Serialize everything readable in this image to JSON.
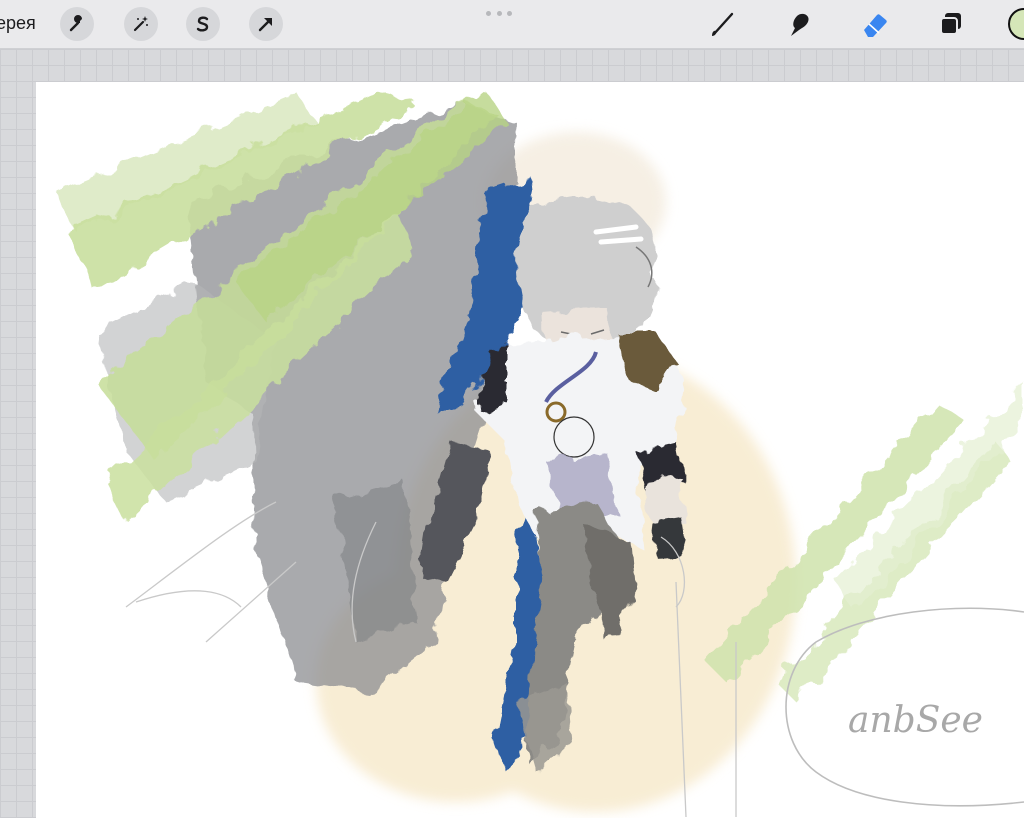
{
  "toolbar": {
    "gallery_label": "ерея",
    "left_tools": [
      {
        "name": "actions",
        "icon": "wrench-icon"
      },
      {
        "name": "adjustments",
        "icon": "magic-wand-icon"
      },
      {
        "name": "selection",
        "icon": "selection-s-icon"
      },
      {
        "name": "transform",
        "icon": "arrow-cursor-icon"
      }
    ],
    "right_tools": [
      {
        "name": "brush",
        "icon": "brush-icon"
      },
      {
        "name": "smudge",
        "icon": "smudge-finger-icon"
      },
      {
        "name": "eraser",
        "icon": "eraser-icon",
        "active": true
      },
      {
        "name": "layers",
        "icon": "layers-icon"
      }
    ],
    "active_color": "#d5e6b8",
    "accent_color": "#3a86f0"
  },
  "canvas": {
    "sketch_text": "anbSee",
    "palette": {
      "green": "#c9df9e",
      "gray": "#8c8d91",
      "blue": "#2f5fa3",
      "cream": "#f6e7c6",
      "hair": "#cfcfcf"
    }
  }
}
